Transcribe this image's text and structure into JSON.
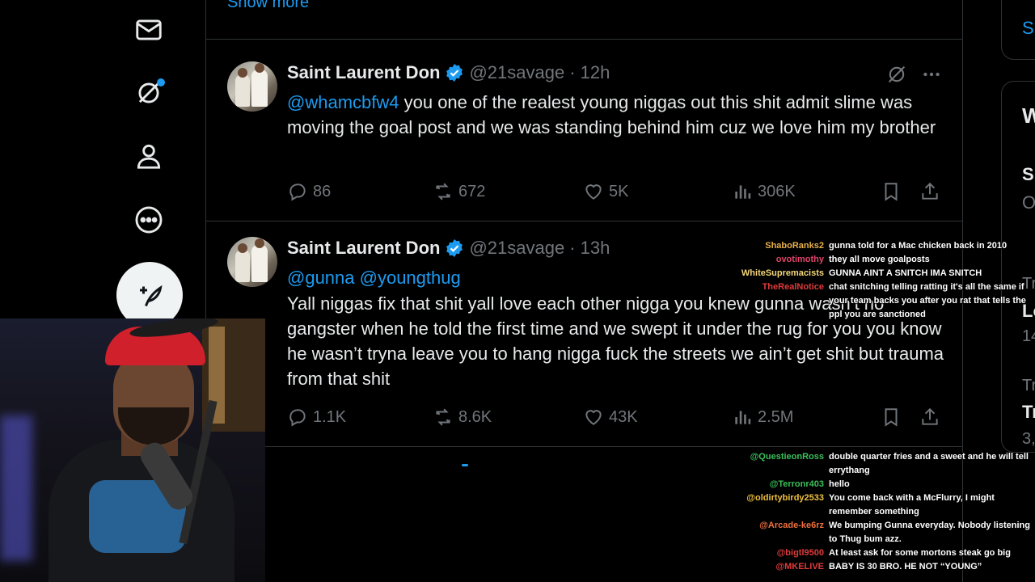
{
  "nav": {
    "items": [
      "messages",
      "grok",
      "profile",
      "more"
    ],
    "grok_has_badge": true,
    "post_button": "compose-post"
  },
  "feed": {
    "show_more": "Show more",
    "tweets": [
      {
        "name": "Saint Laurent Don",
        "handle": "@21savage",
        "time": "· 12h",
        "mentions": "@whamcbfw4",
        "text": " you one of the realest young niggas out this shit admit slime was moving the goal post and we was standing behind him cuz we love him my brother",
        "replies": "86",
        "reposts": "672",
        "likes": "5K",
        "views": "306K"
      },
      {
        "name": "Saint Laurent Don",
        "handle": "@21savage",
        "time": "· 13h",
        "mentions": "@gunna @youngthug",
        "text": "Yall niggas fix that shit yall love each other nigga you knew gunna wasn’t no gangster when he told the first time and we swept it under the rug for you you know he wasn’t tryna leave you to hang nigga fuck the streets we ain’t get shit but trauma from that shit",
        "replies": "1.1K",
        "reposts": "8.6K",
        "likes": "43K",
        "views": "2.5M"
      }
    ]
  },
  "right": {
    "frag1": "S",
    "frag2": "W",
    "frag3": "S",
    "frag4": "O",
    "frag5": "Tr",
    "frag6": "Lo",
    "frag7": "14",
    "frag8": "Tr",
    "frag9": "Tr",
    "frag10": "3,"
  },
  "chat_top": [
    {
      "user": "ShaboRanks2",
      "color": "#e8b04a",
      "text": "gunna told for a Mac chicken back in 2010"
    },
    {
      "user": "ovotimothy",
      "color": "#e0456a",
      "text": "they all move goalposts"
    },
    {
      "user": "WhiteSupremacists",
      "color": "#f4d77a",
      "text": "GUNNA AINT A SNITCH IMA SNITCH"
    },
    {
      "user": "TheRealNotice",
      "color": "#e03a3a",
      "text": "chat snitching telling ratting it's all the same if your team backs you after you rat that tells the ppl you are sanctioned"
    }
  ],
  "chat_bottom": [
    {
      "user": "@QuestieonRoss",
      "color": "#3bbf5a",
      "text": "double quarter fries and a sweet and he will tell errythang"
    },
    {
      "user": "@Terronr403",
      "color": "#3bbf5a",
      "text": "hello"
    },
    {
      "user": "@oldirtybirdy2533",
      "color": "#f0c040",
      "text": "You come back with a McFlurry, I might remember something"
    },
    {
      "user": "@Arcade-ke6rz",
      "color": "#f07040",
      "text": "We bumping Gunna everyday. Nobody listening to Thug bum azz."
    },
    {
      "user": "@bigtl9500",
      "color": "#e03a3a",
      "text": "At least ask for some mortons steak go big"
    },
    {
      "user": "@MKELIVE",
      "color": "#e03a3a",
      "text": "BABY IS 30 BRO. HE NOT “YOUNG”"
    }
  ]
}
